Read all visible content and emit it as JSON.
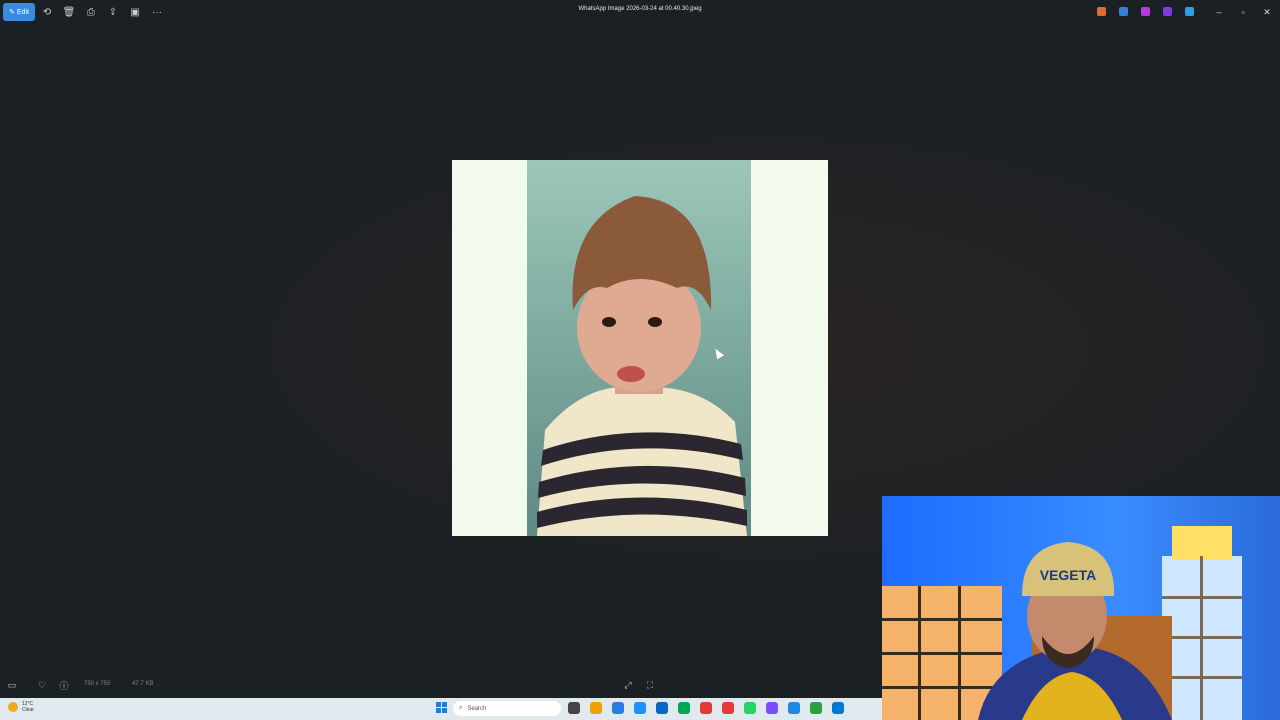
{
  "window": {
    "title": "WhatsApp Image 2026-03-24 at 00.40.30.jpeg",
    "edit_label": "Edit"
  },
  "toolbar": {
    "icons": [
      "edit-icon",
      "rotate-icon",
      "delete-icon",
      "print-icon",
      "share-icon",
      "slideshow-icon",
      "more-icon"
    ]
  },
  "tray": {
    "colors": [
      "#e06b3a",
      "#3a7be0",
      "#b63ae0",
      "#7d3ae0",
      "#2aa2e0"
    ]
  },
  "bottombar": {
    "dimensions": "750 x 750",
    "filesize": "47.7 KB"
  },
  "taskbar": {
    "weather_temp": "12°C",
    "weather_desc": "Clear",
    "search_placeholder": "Search",
    "app_colors": [
      "#444",
      "#f0a000",
      "#2a7de0",
      "#1e90ff",
      "#0a66c2",
      "#00a651",
      "#e53935",
      "#e53935",
      "#25d366",
      "#7c4dff",
      "#1e88e5",
      "#2ea043",
      "#0078d4"
    ]
  }
}
